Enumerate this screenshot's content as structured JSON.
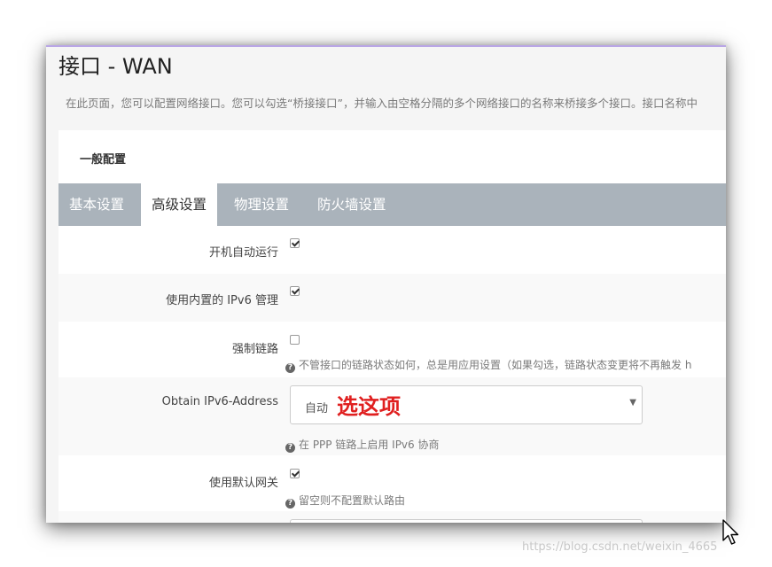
{
  "page": {
    "title": "接口 - WAN",
    "description": "在此页面，您可以配置网络接口。您可以勾选“桥接接口”，并输入由空格分隔的多个网络接口的名称来桥接多个接口。接口名称中"
  },
  "section": {
    "title": "一般配置"
  },
  "tabs": [
    {
      "label": "基本设置",
      "active": false
    },
    {
      "label": "高级设置",
      "active": true
    },
    {
      "label": "物理设置",
      "active": false
    },
    {
      "label": "防火墙设置",
      "active": false
    }
  ],
  "fields": {
    "auto_start": {
      "label": "开机自动运行",
      "checked": true
    },
    "builtin_ipv6": {
      "label": "使用内置的 IPv6 管理",
      "checked": true
    },
    "force_link": {
      "label": "强制链路",
      "checked": false,
      "help": "不管接口的链路状态如何，总是用应用设置（如果勾选，链路状态变更将不再触发 h"
    },
    "obtain_ipv6": {
      "label": "Obtain IPv6-Address",
      "value": "自动",
      "annotation": "选这项",
      "help": "在 PPP 链路上启用 IPv6 协商"
    },
    "default_gateway": {
      "label": "使用默认网关",
      "checked": true,
      "help": "留空则不配置默认路由"
    }
  },
  "watermark": "https://blog.csdn.net/weixin_4665",
  "colors": {
    "tab_bar": "#aab3bb",
    "annotation": "#e02020",
    "frame_top": "#b9a6e6"
  }
}
